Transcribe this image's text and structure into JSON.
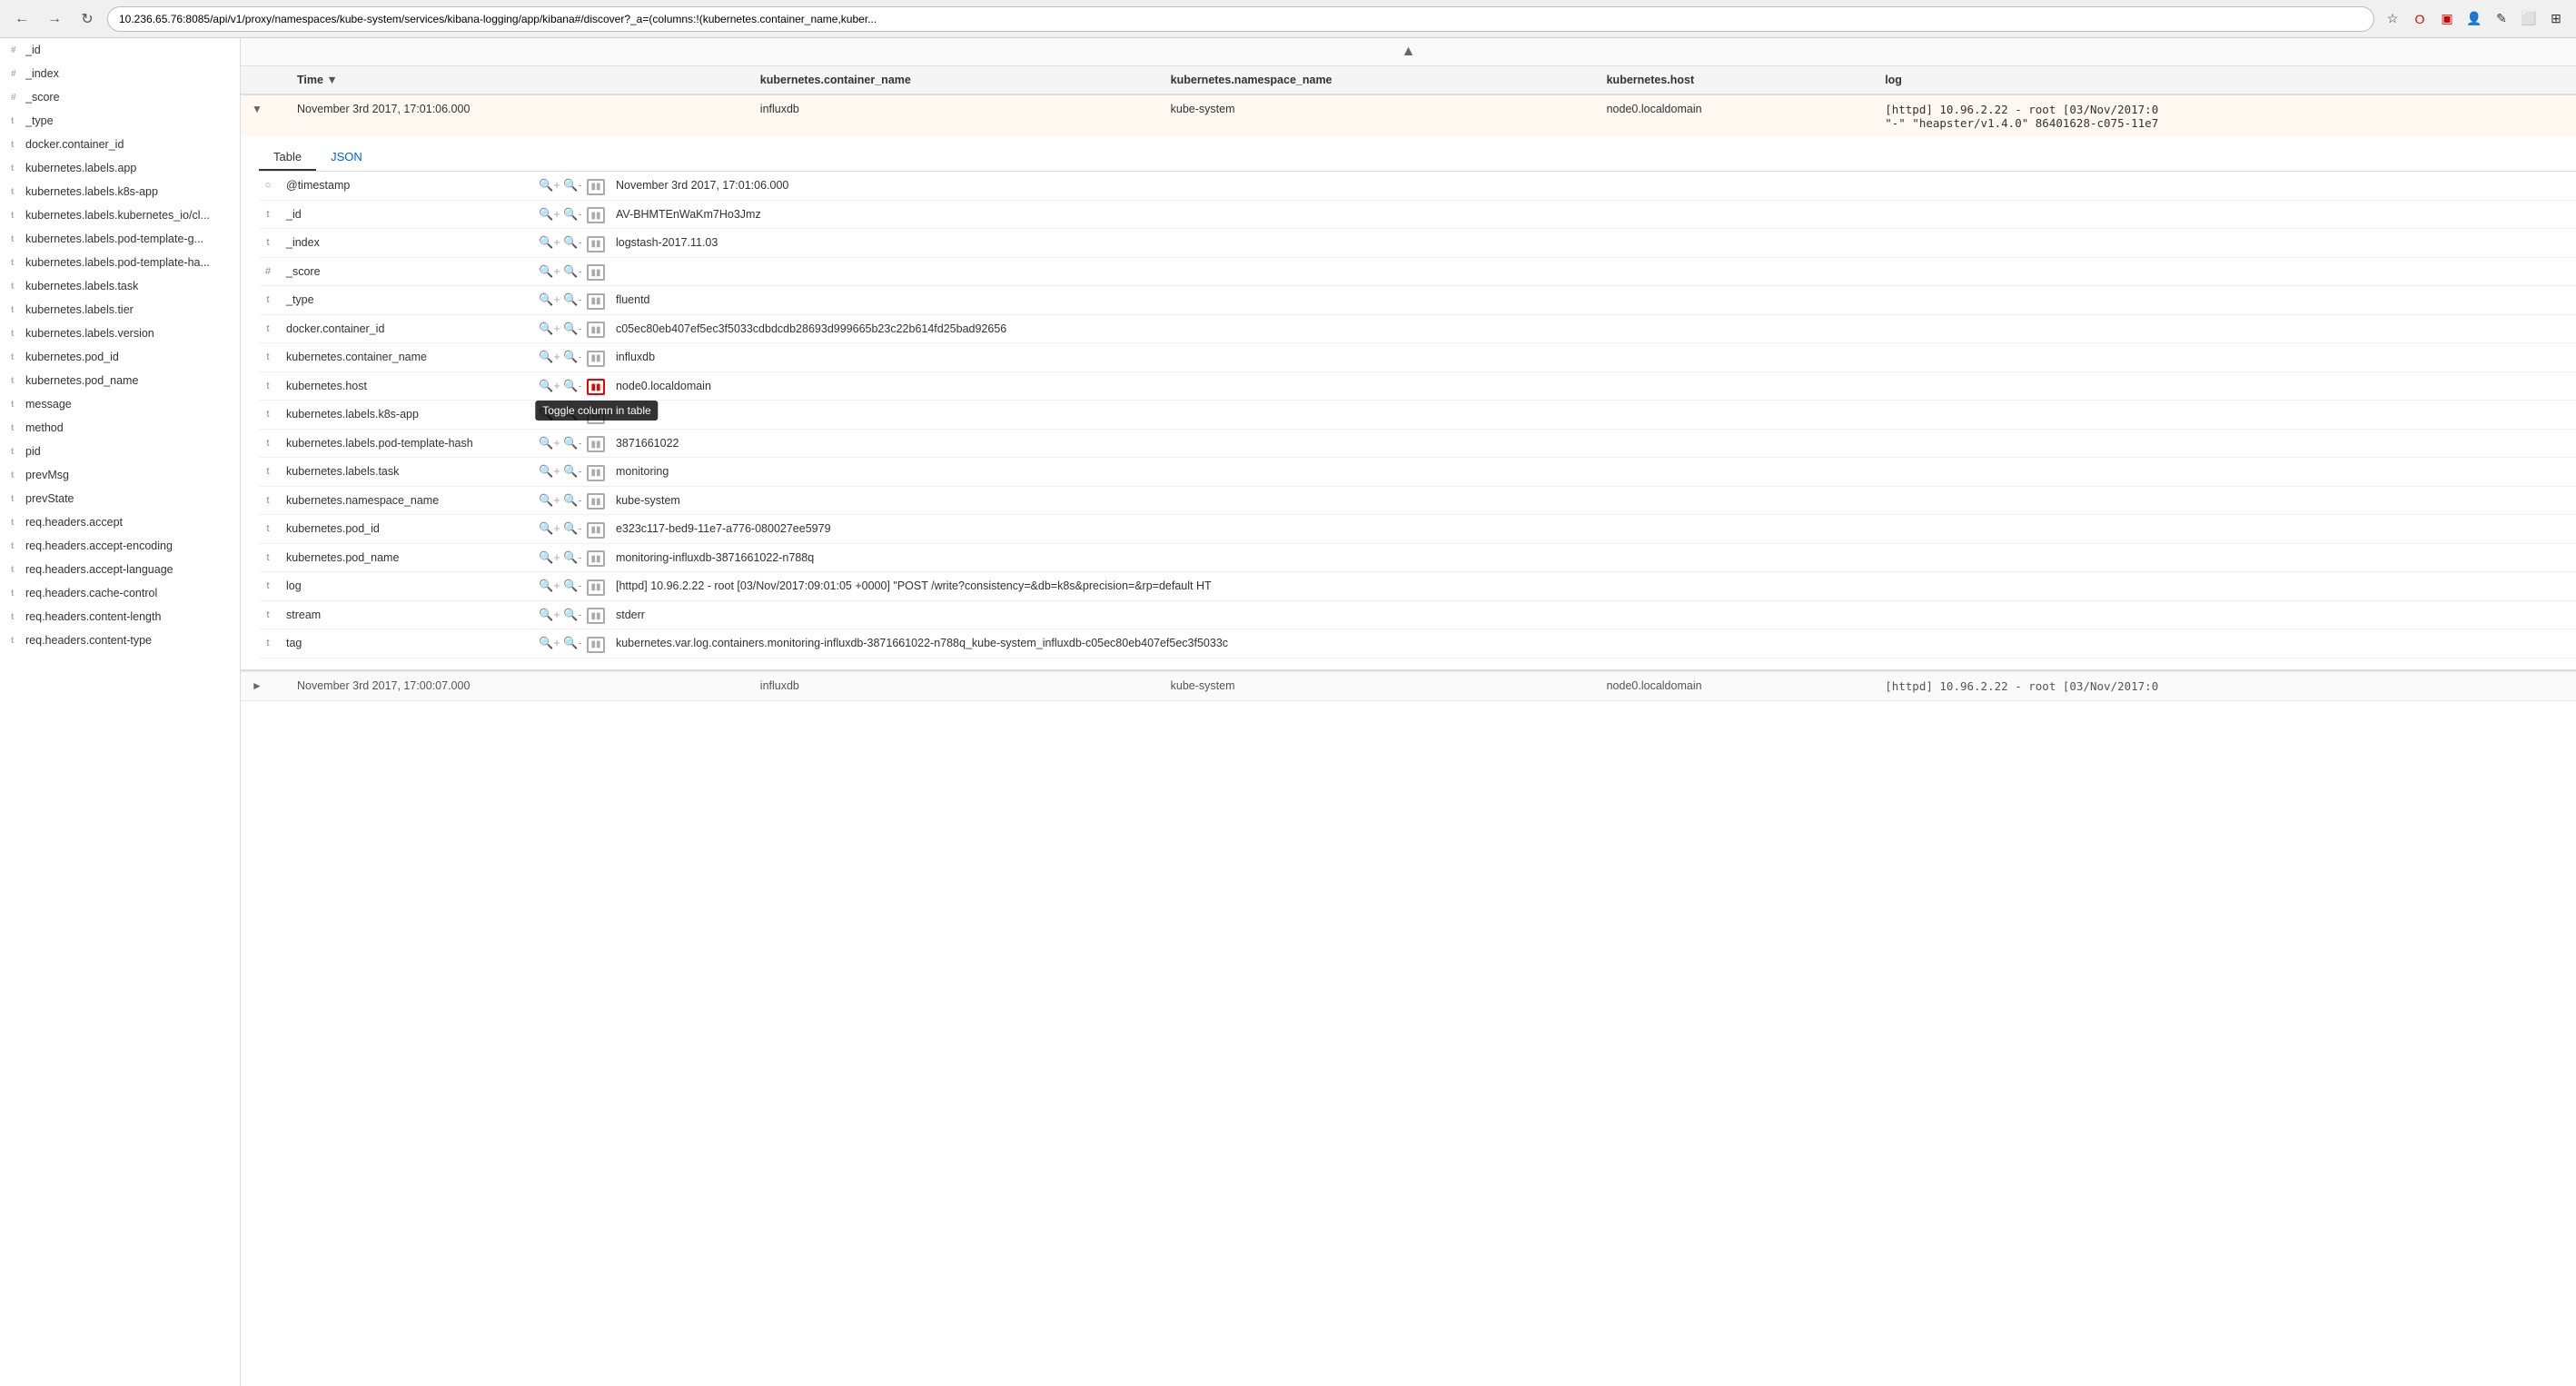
{
  "browser": {
    "url": "10.236.65.76:8085/api/v1/proxy/namespaces/kube-system/services/kibana-logging/app/kibana#/discover?_a=(columns:!(kubernetes.container_name,kuber...",
    "back": "←",
    "forward": "→",
    "refresh": "↻"
  },
  "sidebar": {
    "items": [
      {
        "type": "_id",
        "icon": "#",
        "label": "_id"
      },
      {
        "type": "_index",
        "icon": "#",
        "label": "_index"
      },
      {
        "type": "_score",
        "icon": "#",
        "label": "_score"
      },
      {
        "type": "_type",
        "icon": "t",
        "label": "_type"
      },
      {
        "type": "docker.container_id",
        "icon": "t",
        "label": "docker.container_id"
      },
      {
        "type": "kubernetes.labels.app",
        "icon": "t",
        "label": "kubernetes.labels.app"
      },
      {
        "type": "kubernetes.labels.k8s-app",
        "icon": "t",
        "label": "kubernetes.labels.k8s-app"
      },
      {
        "type": "kubernetes.labels.kubernetes_io/cl...",
        "icon": "t",
        "label": "kubernetes.labels.kubernetes_io/cl..."
      },
      {
        "type": "kubernetes.labels.pod-template-g...",
        "icon": "t",
        "label": "kubernetes.labels.pod-template-g..."
      },
      {
        "type": "kubernetes.labels.pod-template-ha...",
        "icon": "t",
        "label": "kubernetes.labels.pod-template-ha..."
      },
      {
        "type": "kubernetes.labels.task",
        "icon": "t",
        "label": "kubernetes.labels.task"
      },
      {
        "type": "kubernetes.labels.tier",
        "icon": "t",
        "label": "kubernetes.labels.tier"
      },
      {
        "type": "kubernetes.labels.version",
        "icon": "t",
        "label": "kubernetes.labels.version"
      },
      {
        "type": "kubernetes.pod_id",
        "icon": "t",
        "label": "kubernetes.pod_id"
      },
      {
        "type": "kubernetes.pod_name",
        "icon": "t",
        "label": "kubernetes.pod_name"
      },
      {
        "type": "message",
        "icon": "t",
        "label": "message"
      },
      {
        "type": "method",
        "icon": "t",
        "label": "method"
      },
      {
        "type": "pid",
        "icon": "t",
        "label": "pid"
      },
      {
        "type": "prevMsg",
        "icon": "t",
        "label": "prevMsg"
      },
      {
        "type": "prevState",
        "icon": "t",
        "label": "prevState"
      },
      {
        "type": "req.headers.accept",
        "icon": "t",
        "label": "req.headers.accept"
      },
      {
        "type": "req.headers.accept-encoding",
        "icon": "t",
        "label": "req.headers.accept-encoding"
      },
      {
        "type": "req.headers.accept-language",
        "icon": "t",
        "label": "req.headers.accept-language"
      },
      {
        "type": "req.headers.cache-control",
        "icon": "t",
        "label": "req.headers.cache-control"
      },
      {
        "type": "req.headers.content-length",
        "icon": "t",
        "label": "req.headers.content-length"
      },
      {
        "type": "req.headers.content-type",
        "icon": "t",
        "label": "req.headers.content-type"
      }
    ]
  },
  "table": {
    "columns": [
      {
        "id": "expand",
        "label": ""
      },
      {
        "id": "time",
        "label": "Time",
        "sort": "▼"
      },
      {
        "id": "container_name",
        "label": "kubernetes.container_name"
      },
      {
        "id": "namespace_name",
        "label": "kubernetes.namespace_name"
      },
      {
        "id": "host",
        "label": "kubernetes.host"
      },
      {
        "id": "log",
        "label": "log"
      }
    ],
    "rows": [
      {
        "time": "November 3rd 2017, 17:01:06.000",
        "container_name": "influxdb",
        "namespace_name": "kube-system",
        "host": "node0.localdomain",
        "log": "[httpd] 10.96.2.22 - root [03/Nov/2017:0\"-\" \"heapster/v1.4.0\" 86401628-c075-11e7",
        "expanded": true
      },
      {
        "time": "November 3rd 2017, 17:00:07.000",
        "container_name": "influxdb",
        "namespace_name": "kube-system",
        "host": "node0.localdomain",
        "log": "[httpd] 10.96.2.22 - root [03/Nov/2017:0",
        "expanded": false
      }
    ]
  },
  "detail": {
    "tabs": [
      {
        "id": "table",
        "label": "Table",
        "active": true
      },
      {
        "id": "json",
        "label": "JSON",
        "active": false
      }
    ],
    "fields": [
      {
        "type": "○",
        "name": "@timestamp",
        "value": "November 3rd 2017, 17:01:06.000"
      },
      {
        "type": "t",
        "name": "_id",
        "value": "AV-BHMTEnWaKm7Ho3Jmz"
      },
      {
        "type": "t",
        "name": "_index",
        "value": "logstash-2017.11.03"
      },
      {
        "type": "#",
        "name": "_score",
        "value": ""
      },
      {
        "type": "t",
        "name": "_type",
        "value": "fluentd"
      },
      {
        "type": "t",
        "name": "docker.container_id",
        "value": "c05ec80eb407ef5ec3f5033cdbdcdb28693d999665b23c22b614fd25bad92656"
      },
      {
        "type": "t",
        "name": "kubernetes.container_name",
        "value": "influxdb"
      },
      {
        "type": "t",
        "name": "kubernetes.host",
        "value": "node0.localdomain",
        "tooltip": "Toggle column in table"
      },
      {
        "type": "t",
        "name": "kubernetes.labels.k8s-app",
        "value": "p",
        "has_tooltip": true
      },
      {
        "type": "t",
        "name": "kubernetes.labels.pod-template-hash",
        "value": "3871661022"
      },
      {
        "type": "t",
        "name": "kubernetes.labels.task",
        "value": "monitoring"
      },
      {
        "type": "t",
        "name": "kubernetes.namespace_name",
        "value": "kube-system"
      },
      {
        "type": "t",
        "name": "kubernetes.pod_id",
        "value": "e323c117-bed9-11e7-a776-080027ee5979"
      },
      {
        "type": "t",
        "name": "kubernetes.pod_name",
        "value": "monitoring-influxdb-3871661022-n788q"
      },
      {
        "type": "t",
        "name": "log",
        "value": "[httpd] 10.96.2.22 - root [03/Nov/2017:09:01:05 +0000] \"POST /write?consistency=&db=k8s&precision=&rp=default HT"
      },
      {
        "type": "t",
        "name": "stream",
        "value": "stderr"
      },
      {
        "type": "t",
        "name": "tag",
        "value": "kubernetes.var.log.containers.monitoring-influxdb-3871661022-n788q_kube-system_influxdb-c05ec80eb407ef5ec3f5033c"
      }
    ],
    "tooltip_text": "Toggle column in table"
  }
}
